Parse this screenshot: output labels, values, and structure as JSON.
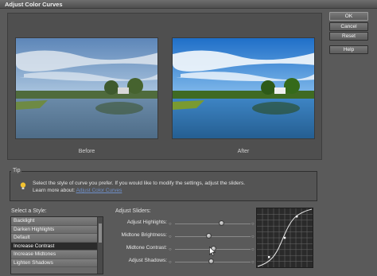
{
  "window": {
    "title": "Adjust Color Curves"
  },
  "buttons": {
    "ok": "OK",
    "cancel": "Cancel",
    "reset": "Reset",
    "help": "Help"
  },
  "preview": {
    "before_label": "Before",
    "after_label": "After"
  },
  "tip": {
    "group_label": "Tip",
    "text": "Select the style of curve you prefer. If you would like to modify the settings, adjust the sliders.",
    "learn_more_prefix": "Learn more about:",
    "learn_more_link": "Adjust Color Curves"
  },
  "styles": {
    "label": "Select a Style:",
    "items": [
      "Backlight",
      "Darken Highlights",
      "Default",
      "Increase Contrast",
      "Increase Midtones",
      "Lighten Shadows"
    ],
    "selected_index": 3
  },
  "sliders": {
    "label": "Adjust Sliders:",
    "items": [
      {
        "label": "Adjust Highlights:",
        "level": 0.62
      },
      {
        "label": "Midtone Brightness:",
        "level": 0.45
      },
      {
        "label": "Midtone Contrast:",
        "level": 0.52
      },
      {
        "label": "Adjust Shadows:",
        "level": 0.48
      }
    ]
  },
  "colors": {
    "panel": "#4f4f4f",
    "selected_row": "#2b2b2b",
    "link": "#6f8fc8"
  }
}
